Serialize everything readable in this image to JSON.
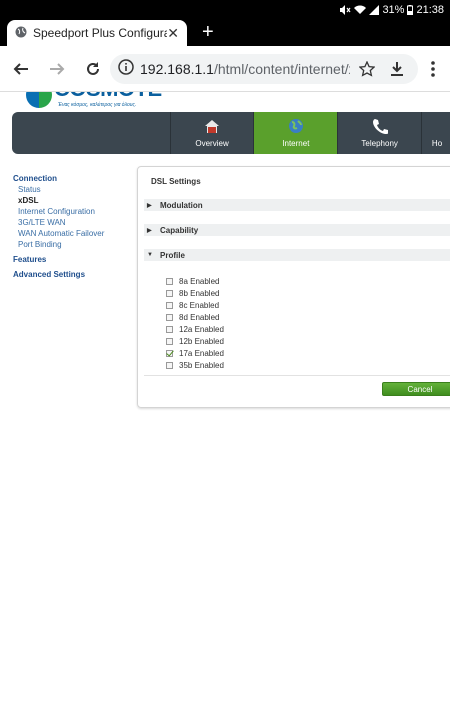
{
  "statusbar": {
    "battery": "31%",
    "time": "21:38"
  },
  "browser": {
    "tab_title": "Speedport Plus Configuratio",
    "url_host": "192.168.1.1",
    "url_path": "/html/content/internet/xdsl"
  },
  "brand": {
    "logo_text": "COSMOTE",
    "slogan": "Ένας κόσμος, καλύτερος για όλους."
  },
  "nav": {
    "items": [
      {
        "label": "Overview",
        "icon": "home-icon",
        "active": false
      },
      {
        "label": "Internet",
        "icon": "globe-icon",
        "active": true
      },
      {
        "label": "Telephony",
        "icon": "phone-icon",
        "active": false
      },
      {
        "label": "Ho"
      }
    ]
  },
  "sidebar": {
    "connection": "Connection",
    "items": [
      "Status",
      "xDSL",
      "Internet Configuration",
      "3G/LTE WAN",
      "WAN Automatic Failover",
      "Port Binding"
    ],
    "features": "Features",
    "advanced": "Advanced Settings"
  },
  "panel": {
    "title": "DSL Settings",
    "sections": [
      "Modulation",
      "Capability",
      "Profile"
    ],
    "profiles": [
      {
        "label": "8a Enabled",
        "checked": false
      },
      {
        "label": "8b Enabled",
        "checked": false
      },
      {
        "label": "8c Enabled",
        "checked": false
      },
      {
        "label": "8d Enabled",
        "checked": false
      },
      {
        "label": "12a Enabled",
        "checked": false
      },
      {
        "label": "12b Enabled",
        "checked": false
      },
      {
        "label": "17a Enabled",
        "checked": true
      },
      {
        "label": "35b Enabled",
        "checked": false
      }
    ],
    "cancel_label": "Cancel"
  },
  "colors": {
    "accent_green": "#5aa02c",
    "nav_dark": "#3b464f",
    "link_blue": "#2a5d96"
  }
}
